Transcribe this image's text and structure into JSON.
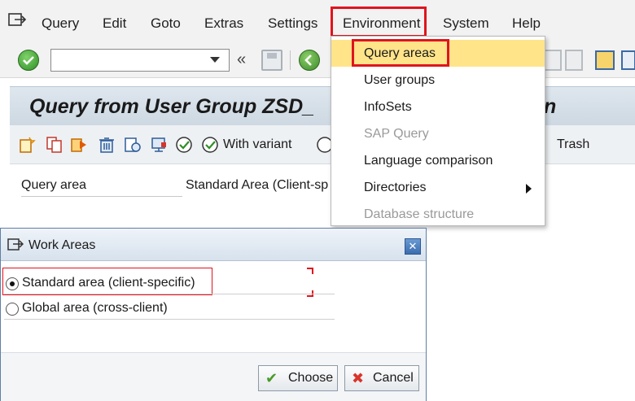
{
  "menubar": {
    "items": [
      "Query",
      "Edit",
      "Goto",
      "Extras",
      "Settings",
      "Environment",
      "System",
      "Help"
    ]
  },
  "dropdown": {
    "items": [
      {
        "label": "Query areas",
        "state": "highlighted"
      },
      {
        "label": "User groups",
        "state": "enabled"
      },
      {
        "label": "InfoSets",
        "state": "enabled"
      },
      {
        "label": "SAP Query",
        "state": "disabled"
      },
      {
        "label": "Language comparison",
        "state": "enabled"
      },
      {
        "label": "Directories",
        "state": "submenu"
      },
      {
        "label": "Database structure",
        "state": "disabled"
      }
    ]
  },
  "main": {
    "title": "Query from User Group ZSD_",
    "title_tail": "n",
    "toolbar": {
      "with_variant": "With variant",
      "trash": "Trash"
    },
    "query_area_label": "Query area",
    "query_area_value": "Standard Area (Client-sp"
  },
  "dialog": {
    "title": "Work Areas",
    "options": [
      {
        "label": "Standard area (client-specific)",
        "selected": true
      },
      {
        "label": "Global area (cross-client)",
        "selected": false
      }
    ],
    "choose_label": "Choose",
    "cancel_label": "Cancel"
  },
  "colors": {
    "highlight": "#ffe48a",
    "annotation": "#e0141e",
    "title_bar": "#cdd8e2"
  }
}
